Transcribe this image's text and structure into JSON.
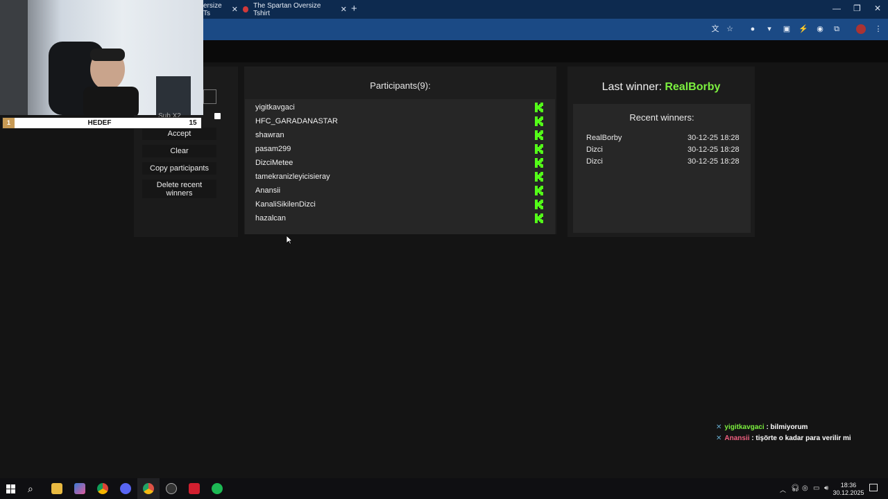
{
  "browser": {
    "tab_partial": "ersize Ts",
    "tab_active": "The Spartan Oversize Tshirt",
    "new_tab": "+",
    "close": "✕"
  },
  "controls": {
    "accept": "Accept",
    "clear": "Clear",
    "copy": "Copy participants",
    "delete": "Delete recent winners"
  },
  "participants": {
    "title": "Participants(9):",
    "list": [
      "yigitkavgaci",
      "HFC_GARADANASTAR",
      "shawran",
      "pasam299",
      "DizciMetee",
      "tamekranizleyicisieray",
      "Anansii",
      "KanaliSikilenDizci",
      "hazalcan"
    ]
  },
  "winner": {
    "last_label": "Last winner: ",
    "last_name": "RealBorby",
    "recent_title": "Recent winners:",
    "recent": [
      {
        "name": "RealBorby",
        "date": "30-12-25 18:28"
      },
      {
        "name": "Dizci",
        "date": "30-12-25 18:28"
      },
      {
        "name": "Dizci",
        "date": "30-12-25 18:28"
      }
    ]
  },
  "overlay": {
    "goal_index": "1",
    "goal_label": "HEDEF",
    "goal_value": "15",
    "sub_label": "Sub X2"
  },
  "chat": [
    {
      "user": "yigitkavgaci",
      "message": ": bilmiyorum",
      "color": "#7cf03f"
    },
    {
      "user": "Anansii",
      "message": ": tişörte o kadar para verilir mi",
      "color": "#f06080"
    }
  ],
  "taskbar": {
    "time": "18:36",
    "date": "30.12.2025"
  },
  "colors": {
    "accent_green": "#53fc18",
    "winner_green": "#7cf03f"
  }
}
